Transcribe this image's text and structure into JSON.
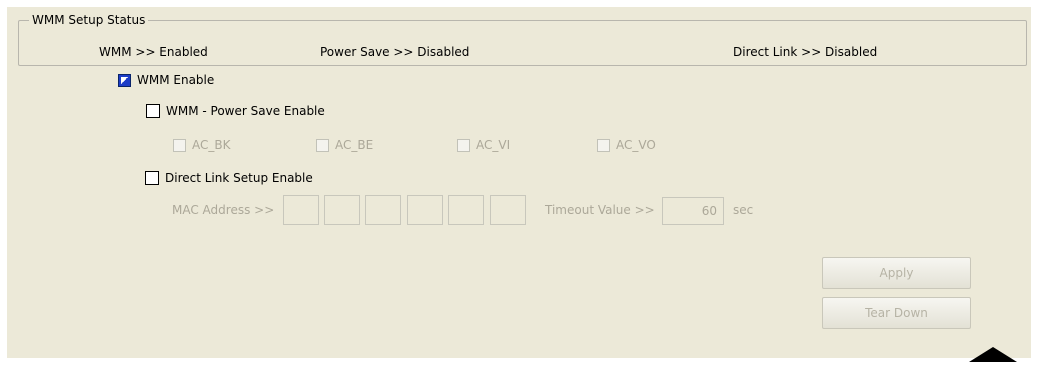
{
  "status_group": {
    "title": "WMM Setup Status",
    "wmm": "WMM >> Enabled",
    "power_save": "Power Save >> Disabled",
    "direct_link": "Direct Link >> Disabled"
  },
  "wmm_enable": {
    "label": "WMM Enable",
    "checked": true
  },
  "power_save_enable": {
    "label": "WMM - Power Save Enable",
    "checked": false
  },
  "access_categories": [
    {
      "label": "AC_BK",
      "checked": false,
      "enabled": false
    },
    {
      "label": "AC_BE",
      "checked": false,
      "enabled": false
    },
    {
      "label": "AC_VI",
      "checked": false,
      "enabled": false
    },
    {
      "label": "AC_VO",
      "checked": false,
      "enabled": false
    }
  ],
  "direct_link_enable": {
    "label": "Direct Link Setup Enable",
    "checked": false
  },
  "mac_address": {
    "label": "MAC Address >>",
    "octets": [
      "",
      "",
      "",
      "",
      "",
      ""
    ]
  },
  "timeout": {
    "label": "Timeout Value >>",
    "value": "60",
    "unit": "sec"
  },
  "buttons": {
    "apply": "Apply",
    "tear_down": "Tear Down"
  },
  "colors": {
    "panel_bg": "#ece9d8",
    "checkbox_checked": "#1d3dc7",
    "disabled_text": "#aca899"
  }
}
